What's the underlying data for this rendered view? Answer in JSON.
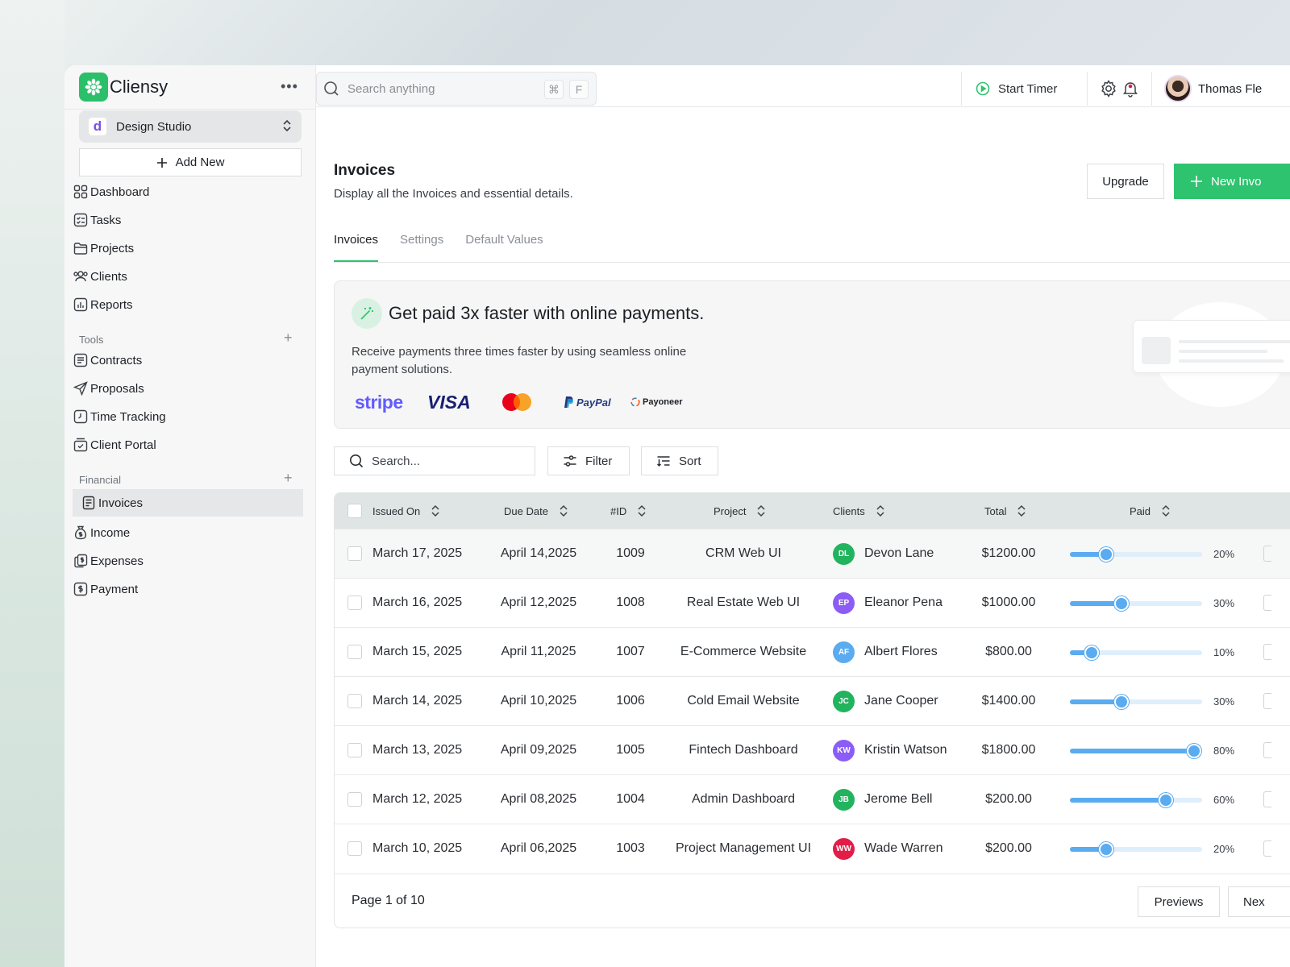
{
  "brand": {
    "name": "Cliensy",
    "color": "#2bbf6a"
  },
  "workspace": {
    "badge": "d",
    "name": "Design Studio"
  },
  "sidebar": {
    "add_new": "Add New",
    "main_items": [
      {
        "label": "Dashboard",
        "icon": "grid-icon"
      },
      {
        "label": "Tasks",
        "icon": "checklist-icon"
      },
      {
        "label": "Projects",
        "icon": "folder-icon"
      },
      {
        "label": "Clients",
        "icon": "users-icon"
      },
      {
        "label": "Reports",
        "icon": "bar-chart-icon"
      }
    ],
    "tools_label": "Tools",
    "tools_items": [
      {
        "label": "Contracts",
        "icon": "document-icon"
      },
      {
        "label": "Proposals",
        "icon": "send-icon"
      },
      {
        "label": "Time Tracking",
        "icon": "clock-icon"
      },
      {
        "label": "Client Portal",
        "icon": "portal-icon"
      }
    ],
    "financial_label": "Financial",
    "financial_items": [
      {
        "label": "Invoices",
        "icon": "invoice-icon",
        "active": true
      },
      {
        "label": "Income",
        "icon": "money-bag-icon"
      },
      {
        "label": "Expenses",
        "icon": "expenses-icon"
      },
      {
        "label": "Payment",
        "icon": "payment-icon"
      }
    ]
  },
  "topbar": {
    "search_placeholder": "Search anything",
    "shortcut_keys": [
      "⌘",
      "F"
    ],
    "start_timer": "Start Timer",
    "user_name": "Thomas Fle"
  },
  "page": {
    "title": "Invoices",
    "subtitle": "Display all the Invoices and essential details.",
    "upgrade_label": "Upgrade",
    "new_label": "New Invo",
    "tabs": [
      "Invoices",
      "Settings",
      "Default Values"
    ],
    "active_tab": "Invoices"
  },
  "promo": {
    "title": "Get paid 3x faster with online payments.",
    "text": "Receive payments three times faster by using seamless online payment solutions.",
    "logos": [
      "stripe",
      "VISA",
      "PayPal",
      "Payoneer"
    ]
  },
  "toolbar": {
    "search_placeholder": "Search...",
    "filter_label": "Filter",
    "sort_label": "Sort"
  },
  "table": {
    "headers": [
      "Issued On",
      "Due Date",
      "#ID",
      "Project",
      "Clients",
      "Total",
      "Paid"
    ],
    "rows": [
      {
        "issued": "March 17, 2025",
        "due": "April 14,2025",
        "id": "1009",
        "project": "CRM Web UI",
        "initials": "DL",
        "client": "Devon Lane",
        "avatar_color": "#22b35e",
        "total": "$1200.00",
        "paid": 20,
        "paid_label": "20%"
      },
      {
        "issued": "March 16, 2025",
        "due": "April 12,2025",
        "id": "1008",
        "project": "Real Estate Web UI",
        "initials": "EP",
        "client": "Eleanor Pena",
        "avatar_color": "#8b5cf6",
        "total": "$1000.00",
        "paid": 30,
        "paid_label": "30%"
      },
      {
        "issued": "March 15, 2025",
        "due": "April 11,2025",
        "id": "1007",
        "project": "E-Commerce Website",
        "initials": "AF",
        "client": "Albert Flores",
        "avatar_color": "#5aabf0",
        "total": "$800.00",
        "paid": 10,
        "paid_label": "10%"
      },
      {
        "issued": "March 14, 2025",
        "due": "April 10,2025",
        "id": "1006",
        "project": "Cold Email Website",
        "initials": "JC",
        "client": "Jane Cooper",
        "avatar_color": "#22b35e",
        "total": "$1400.00",
        "paid": 30,
        "paid_label": "30%"
      },
      {
        "issued": "March 13, 2025",
        "due": "April 09,2025",
        "id": "1005",
        "project": "Fintech Dashboard",
        "initials": "KW",
        "client": "Kristin Watson",
        "avatar_color": "#8b5cf6",
        "total": "$1800.00",
        "paid": 80,
        "paid_label": "80%"
      },
      {
        "issued": "March 12, 2025",
        "due": "April 08,2025",
        "id": "1004",
        "project": "Admin Dashboard",
        "initials": "JB",
        "client": "Jerome Bell",
        "avatar_color": "#22b35e",
        "total": "$200.00",
        "paid": 60,
        "paid_label": "60%"
      },
      {
        "issued": "March 10, 2025",
        "due": "April 06,2025",
        "id": "1003",
        "project": "Project Management UI",
        "initials": "WW",
        "client": "Wade Warren",
        "avatar_color": "#e11d48",
        "total": "$200.00",
        "paid": 20,
        "paid_label": "20%"
      }
    ]
  },
  "pagination": {
    "label": "Page 1 of 10",
    "prev_label": "Previews",
    "next_label": "Nex"
  },
  "colors": {
    "accent": "#2ec36e",
    "progress": "#5aabf0"
  }
}
